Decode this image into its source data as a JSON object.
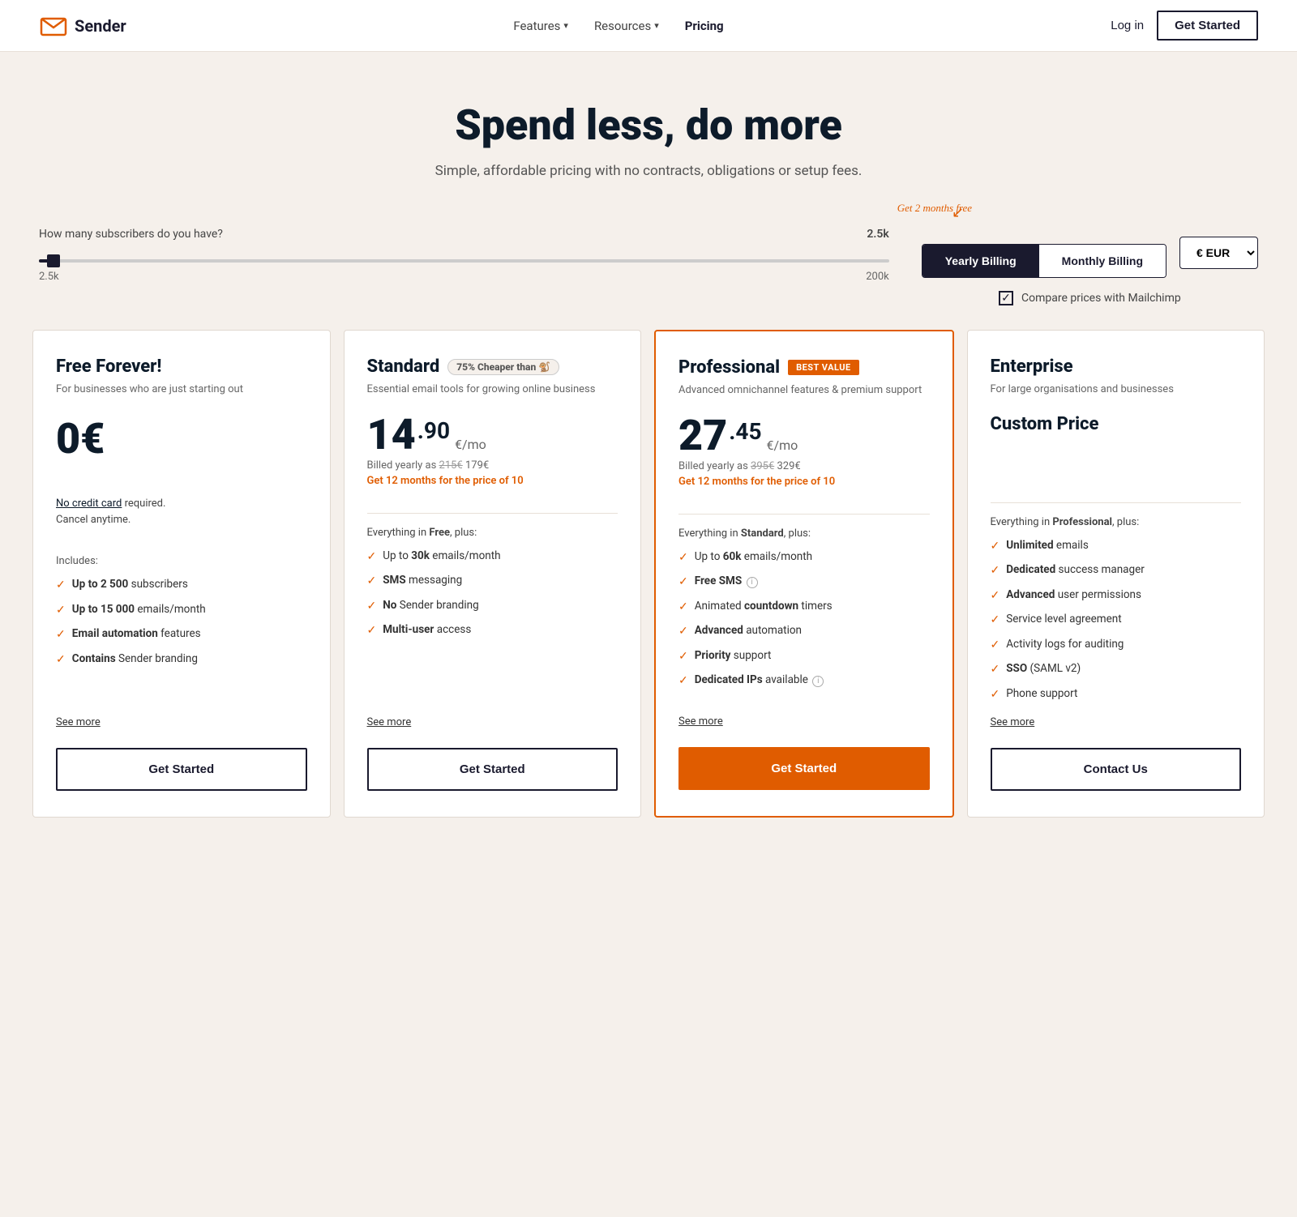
{
  "brand": {
    "name": "Sender"
  },
  "navbar": {
    "features_label": "Features",
    "resources_label": "Resources",
    "pricing_label": "Pricing",
    "login_label": "Log in",
    "get_started_label": "Get Started"
  },
  "hero": {
    "headline": "Spend less, do more",
    "subtext": "Simple, affordable pricing with no contracts, obligations or setup fees."
  },
  "controls": {
    "subscriber_question": "How many subscribers do you have?",
    "subscriber_value": "2.5k",
    "slider_min": "2.5k",
    "slider_max": "200k",
    "free_months_badge": "Get 2 months free",
    "yearly_billing_label": "Yearly Billing",
    "monthly_billing_label": "Monthly Billing",
    "currency_label": "€ EUR",
    "compare_label": "Compare prices with Mailchimp"
  },
  "plans": [
    {
      "id": "free",
      "name": "Free Forever!",
      "badge": null,
      "cheaper_badge": null,
      "desc": "For businesses who are just starting out",
      "price_int": "0",
      "price_symbol": "€",
      "price_decimal": null,
      "price_period": null,
      "billed_line": null,
      "promo": null,
      "no_credit": "No credit card required.\nCancel anytime.",
      "custom_price": null,
      "includes_label": "Includes:",
      "features": [
        {
          "bold_part": "Up to 2 500",
          "rest": " subscribers"
        },
        {
          "bold_part": "Up to 15 000",
          "rest": " emails/month"
        },
        {
          "bold_part": "Email automation",
          "rest": " features"
        },
        {
          "bold_part": "Contains",
          "rest": " Sender branding"
        }
      ],
      "see_more": "See more",
      "cta": "Get Started",
      "featured": false
    },
    {
      "id": "standard",
      "name": "Standard",
      "badge": null,
      "cheaper_badge": "75% Cheaper than 🐒",
      "desc": "Essential email tools for growing online business",
      "price_int": "14",
      "price_symbol": ".",
      "price_decimal": "90",
      "price_period": "€/mo",
      "billed_line": "Billed yearly as 215€ 179€",
      "billed_original": "215€",
      "billed_discounted": "179€",
      "promo": "Get 12 months for the price of 10",
      "no_credit": null,
      "custom_price": null,
      "everything_in": "Everything in Free, plus:",
      "includes_label": null,
      "features": [
        {
          "bold_part": "Up to 30k",
          "rest": " emails/month"
        },
        {
          "bold_part": "SMS",
          "rest": " messaging"
        },
        {
          "bold_part": "No",
          "rest": " Sender branding"
        },
        {
          "bold_part": "Multi-user",
          "rest": " access"
        }
      ],
      "see_more": "See more",
      "cta": "Get Started",
      "featured": false
    },
    {
      "id": "professional",
      "name": "Professional",
      "badge": "BEST VALUE",
      "cheaper_badge": null,
      "desc": "Advanced omnichannel features & premium support",
      "price_int": "27",
      "price_symbol": ".",
      "price_decimal": "45",
      "price_period": "€/mo",
      "billed_line": "Billed yearly as 395€ 329€",
      "billed_original": "395€",
      "billed_discounted": "329€",
      "promo": "Get 12 months for the price of 10",
      "no_credit": null,
      "custom_price": null,
      "everything_in": "Everything in Standard, plus:",
      "includes_label": null,
      "features": [
        {
          "bold_part": "Up to 60k",
          "rest": " emails/month"
        },
        {
          "bold_part": "Free SMS",
          "rest": "",
          "info": true
        },
        {
          "bold_part": "Animated",
          "rest": " countdown timers",
          "bold_word": "countdown"
        },
        {
          "bold_part": "Advanced",
          "rest": " automation"
        },
        {
          "bold_part": "Priority",
          "rest": " support"
        },
        {
          "bold_part": "Dedicated IPs",
          "rest": " available",
          "info": true
        }
      ],
      "see_more": "See more",
      "cta": "Get Started",
      "featured": true
    },
    {
      "id": "enterprise",
      "name": "Enterprise",
      "badge": null,
      "cheaper_badge": null,
      "desc": "For large organisations and businesses",
      "price_int": null,
      "price_symbol": null,
      "price_decimal": null,
      "price_period": null,
      "billed_line": null,
      "promo": null,
      "no_credit": null,
      "custom_price": "Custom Price",
      "everything_in": "Everything in Professional, plus:",
      "includes_label": null,
      "features": [
        {
          "bold_part": "Unlimited",
          "rest": " emails"
        },
        {
          "bold_part": "Dedicated",
          "rest": " success manager"
        },
        {
          "bold_part": "Advanced",
          "rest": " user permissions"
        },
        {
          "bold_part": "",
          "rest": "Service level agreement"
        },
        {
          "bold_part": "",
          "rest": "Activity logs for auditing"
        },
        {
          "bold_part": "SSO",
          "rest": " (SAML v2)"
        },
        {
          "bold_part": "",
          "rest": "Phone support"
        }
      ],
      "see_more": "See more",
      "cta": "Contact Us",
      "featured": false
    }
  ]
}
